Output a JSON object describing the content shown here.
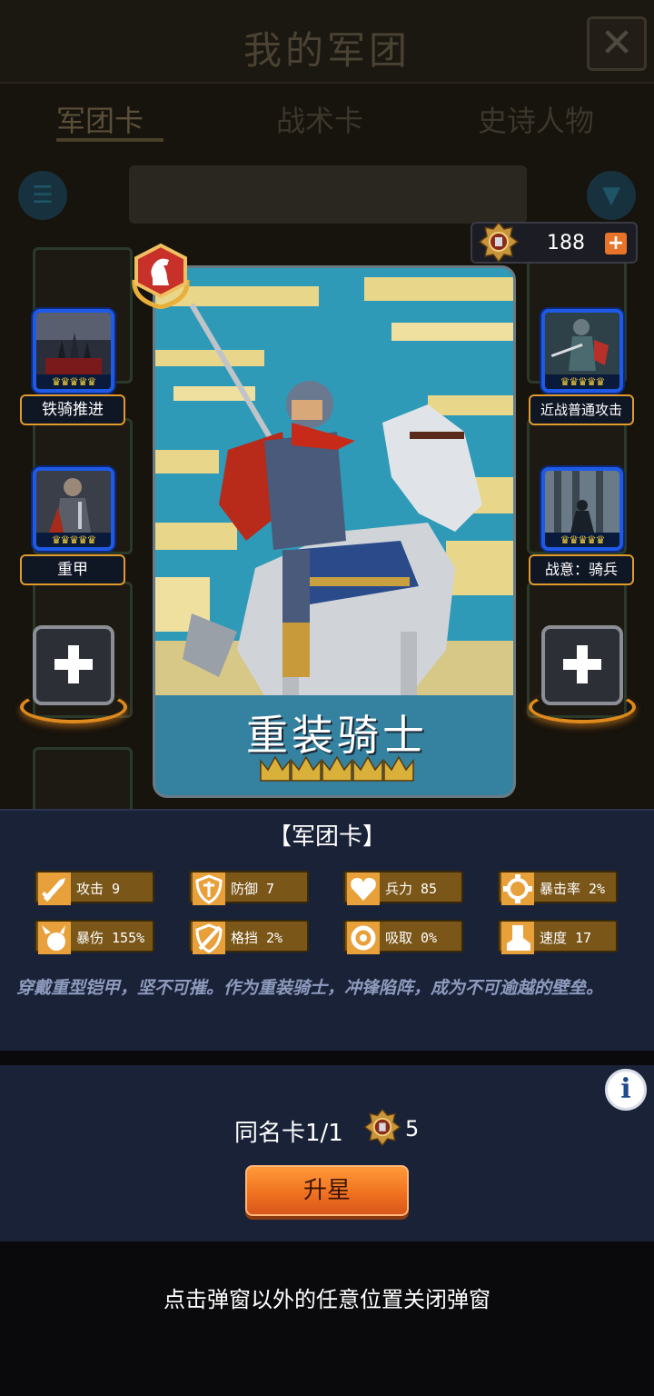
{
  "background_screen": {
    "title": "我的军团",
    "tabs": [
      "军团卡",
      "战术卡",
      "史诗人物"
    ],
    "active_tab": "军团卡"
  },
  "currency": {
    "amount": "188",
    "plus_symbol": "+"
  },
  "skills": {
    "left_top": {
      "label": "铁骑推进",
      "crowns": "♛♛♛♛♛"
    },
    "left_mid": {
      "label": "重甲",
      "crowns": "♛♛♛♛♛"
    },
    "right_top": {
      "label": "近战普通攻击",
      "crowns": "♛♛♛♛♛"
    },
    "right_mid": {
      "label": "战意：骑兵",
      "crowns": "♛♛♛♛♛"
    }
  },
  "card": {
    "name": "重装骑士",
    "stars": 5,
    "rank_icon": "knight-chess-icon"
  },
  "card_type": "【军团卡】",
  "stats": [
    {
      "label": "攻击 9",
      "icon": "sword-icon"
    },
    {
      "label": "防御 7",
      "icon": "shield-icon"
    },
    {
      "label": "兵力 85",
      "icon": "heart-icon"
    },
    {
      "label": "暴击率 2%",
      "icon": "crit-gear-icon"
    },
    {
      "label": "暴伤 155%",
      "icon": "burst-icon"
    },
    {
      "label": "格挡 2%",
      "icon": "block-shield-icon"
    },
    {
      "label": "吸取 0%",
      "icon": "absorb-icon"
    },
    {
      "label": "速度 17",
      "icon": "boot-icon"
    }
  ],
  "description": "穿戴重型铠甲，坚不可摧。作为重装骑士，冲锋陷阵，成为不可逾越的壁垒。",
  "duplicate": {
    "label": "同名卡1/1",
    "count": "5"
  },
  "upgrade_button": "升星",
  "close_hint": "点击弹窗以外的任意位置关闭弹窗",
  "colors": {
    "accent_orange": "#f07220",
    "slot_blue": "#1e5ae6",
    "stat_bg": "#7a5618",
    "panel_bg": "#1a2238"
  }
}
